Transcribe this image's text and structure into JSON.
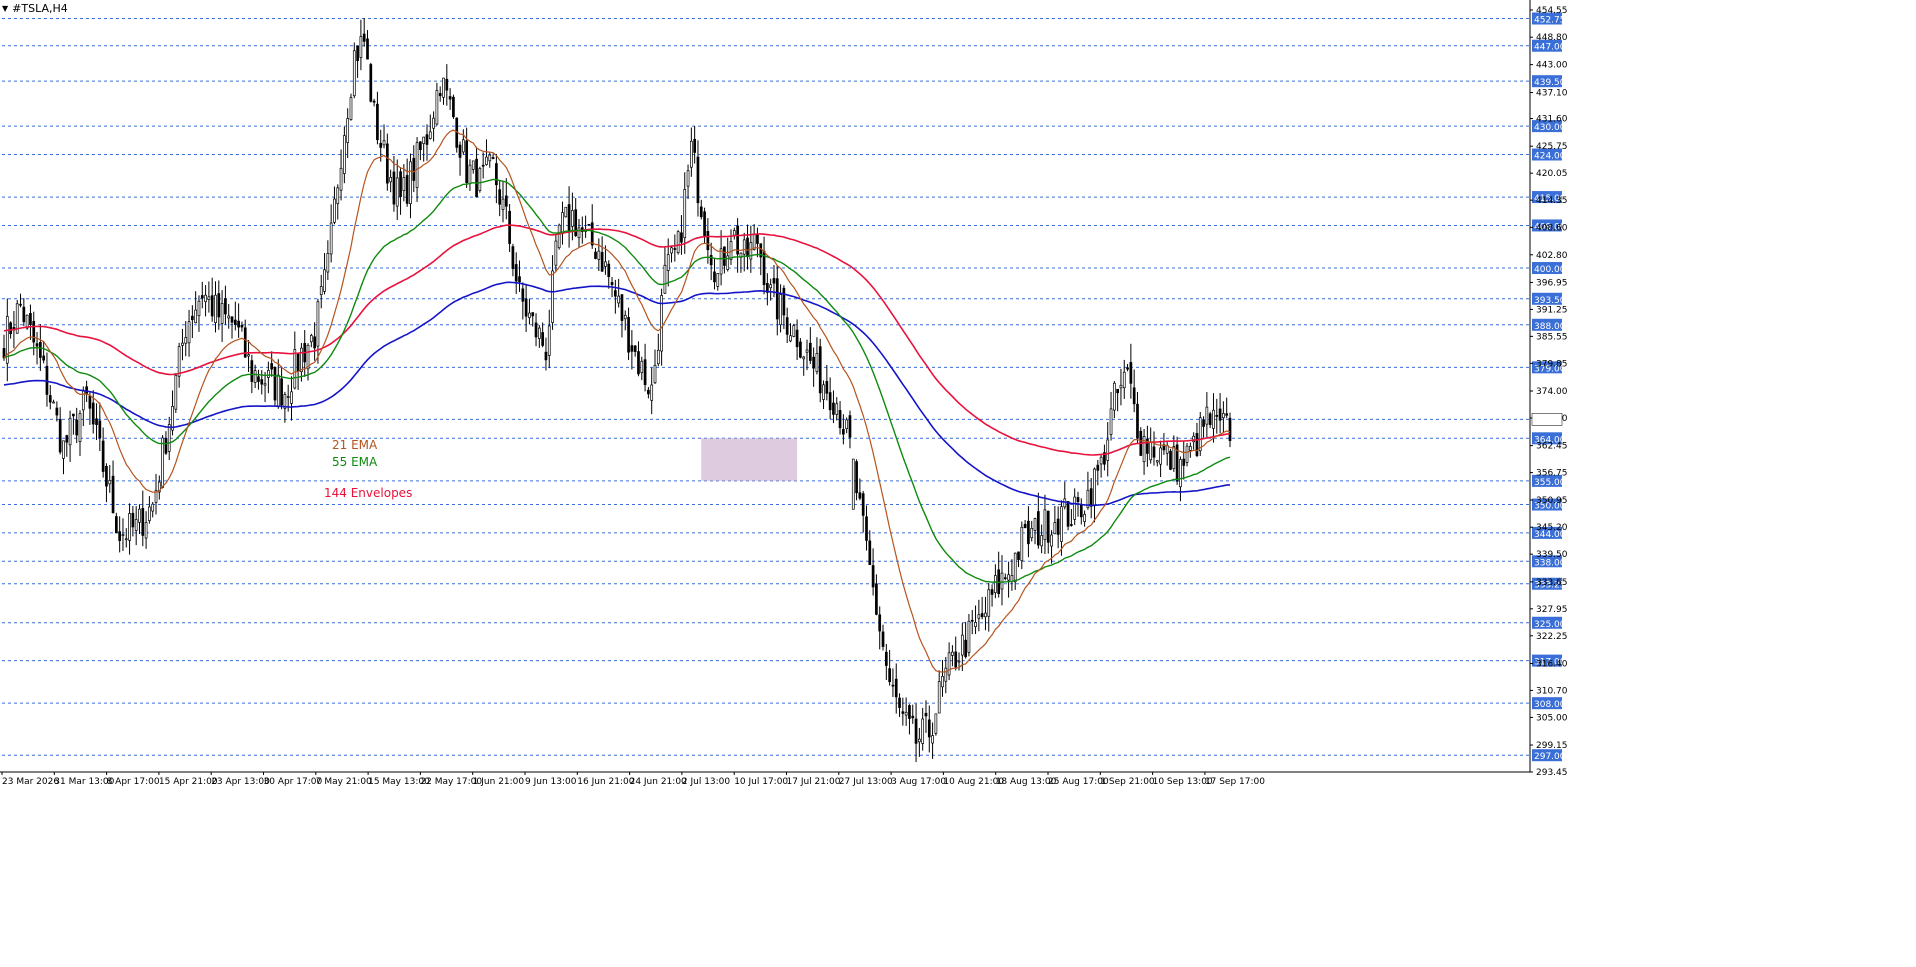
{
  "window": {
    "title": "#TSLA,H4"
  },
  "colors": {
    "ema21": "#b5541e",
    "ema55": "#0e8a0e",
    "envelope": "#e8123c",
    "ema144_mid": "#1414c8",
    "level_line": "#3a6fd8",
    "level_label_bg": "#3a6fd8",
    "zone_fill": "#c9a8c9",
    "candle": "#000000"
  },
  "legend": [
    {
      "label": "21 EMA",
      "color": "#b5541e"
    },
    {
      "label": "55 EMA",
      "color": "#0e8a0e"
    },
    {
      "label": "144 Envelopes",
      "color": "#e8123c"
    }
  ],
  "chart_data": {
    "type": "candlestick",
    "symbol": "#TSLA",
    "timeframe": "H4",
    "ylim": [
      293.45,
      454.55
    ],
    "y_tick_labels": [
      "454.55",
      "448.80",
      "443.00",
      "437.10",
      "431.60",
      "425.75",
      "420.05",
      "414.35",
      "408.60",
      "402.80",
      "396.95",
      "391.25",
      "385.55",
      "379.85",
      "374.00",
      "368.30",
      "362.45",
      "356.75",
      "350.95",
      "345.20",
      "339.50",
      "333.65",
      "327.95",
      "322.25",
      "316.40",
      "310.70",
      "305.00",
      "299.15",
      "293.45"
    ],
    "x_tick_labels": [
      "23 Mar 2026",
      "31 Mar 13:00",
      "8 Apr 17:00",
      "15 Apr 21:00",
      "23 Apr 13:00",
      "30 Apr 17:00",
      "7 May 21:00",
      "15 May 13:00",
      "22 May 17:00",
      "1 Jun 21:00",
      "9 Jun 13:00",
      "16 Jun 21:00",
      "24 Jun 21:00",
      "2 Jul 13:00",
      "10 Jul 17:00",
      "17 Jul 21:00",
      "27 Jul 13:00",
      "3 Aug 17:00",
      "10 Aug 21:00",
      "18 Aug 13:00",
      "25 Aug 17:00",
      "1 Sep 21:00",
      "10 Sep 13:00",
      "17 Sep 17:00"
    ],
    "levels": [
      452.75,
      447.0,
      439.5,
      430.0,
      424.0,
      415.0,
      409.0,
      400.0,
      393.5,
      388.0,
      379.0,
      368.0,
      364.0,
      355.0,
      350.0,
      344.0,
      338.0,
      333.25,
      325.0,
      317.0,
      308.0,
      297.0
    ],
    "level_labels": [
      "452.75",
      "447.00",
      "439.50",
      "430.00",
      "424.00",
      "415.00",
      "409.00",
      "400.00",
      "393.50",
      "388.00",
      "379.00",
      "368.00",
      "364.00",
      "355.00",
      "350.00",
      "344.00",
      "338.00",
      "333.25",
      "325.00",
      "317.00",
      "308.00",
      "297.00"
    ],
    "current_price": 368.0,
    "zone": {
      "top": 364.0,
      "bottom": 355.0,
      "from_index": 211,
      "to_index": 240
    },
    "path_closes": [
      [
        0,
        385
      ],
      [
        5,
        392
      ],
      [
        12,
        378
      ],
      [
        18,
        362
      ],
      [
        25,
        372
      ],
      [
        30,
        358
      ],
      [
        35,
        344
      ],
      [
        40,
        345
      ],
      [
        45,
        350
      ],
      [
        50,
        368
      ],
      [
        55,
        388
      ],
      [
        60,
        395
      ],
      [
        65,
        390
      ],
      [
        70,
        388
      ],
      [
        75,
        378
      ],
      [
        80,
        376
      ],
      [
        85,
        374
      ],
      [
        90,
        382
      ],
      [
        94,
        386
      ],
      [
        98,
        400
      ],
      [
        102,
        425
      ],
      [
        106,
        445
      ],
      [
        109,
        448
      ],
      [
        112,
        432
      ],
      [
        116,
        421
      ],
      [
        120,
        414
      ],
      [
        124,
        421
      ],
      [
        128,
        428
      ],
      [
        132,
        440
      ],
      [
        136,
        432
      ],
      [
        140,
        421
      ],
      [
        144,
        418
      ],
      [
        148,
        421
      ],
      [
        152,
        410
      ],
      [
        156,
        394
      ],
      [
        160,
        388
      ],
      [
        164,
        383
      ],
      [
        168,
        408
      ],
      [
        172,
        411
      ],
      [
        176,
        406
      ],
      [
        180,
        404
      ],
      [
        184,
        396
      ],
      [
        188,
        388
      ],
      [
        192,
        380
      ],
      [
        196,
        374
      ],
      [
        200,
        398
      ],
      [
        204,
        404
      ],
      [
        208,
        425
      ],
      [
        212,
        410
      ],
      [
        216,
        398
      ],
      [
        220,
        408
      ],
      [
        224,
        402
      ],
      [
        228,
        406
      ],
      [
        232,
        394
      ],
      [
        236,
        390
      ],
      [
        240,
        386
      ],
      [
        244,
        380
      ],
      [
        248,
        376
      ],
      [
        252,
        372
      ],
      [
        256,
        362
      ],
      [
        260,
        344
      ],
      [
        264,
        328
      ],
      [
        268,
        312
      ],
      [
        272,
        304
      ],
      [
        276,
        300
      ],
      [
        280,
        302
      ],
      [
        284,
        312
      ],
      [
        288,
        318
      ],
      [
        292,
        322
      ],
      [
        296,
        326
      ],
      [
        300,
        332
      ],
      [
        304,
        336
      ],
      [
        308,
        342
      ],
      [
        312,
        344
      ],
      [
        316,
        346
      ],
      [
        320,
        348
      ],
      [
        324,
        348
      ],
      [
        328,
        352
      ],
      [
        332,
        358
      ],
      [
        336,
        372
      ],
      [
        340,
        377
      ],
      [
        344,
        364
      ],
      [
        348,
        362
      ],
      [
        352,
        360
      ],
      [
        356,
        358
      ],
      [
        360,
        362
      ],
      [
        364,
        368
      ],
      [
        368,
        366
      ],
      [
        371,
        366
      ]
    ],
    "candle_count": 372,
    "series_notes": "EMA 21, EMA 55, 144 Envelopes (upper red, lower/mid blue) computed from closes"
  }
}
